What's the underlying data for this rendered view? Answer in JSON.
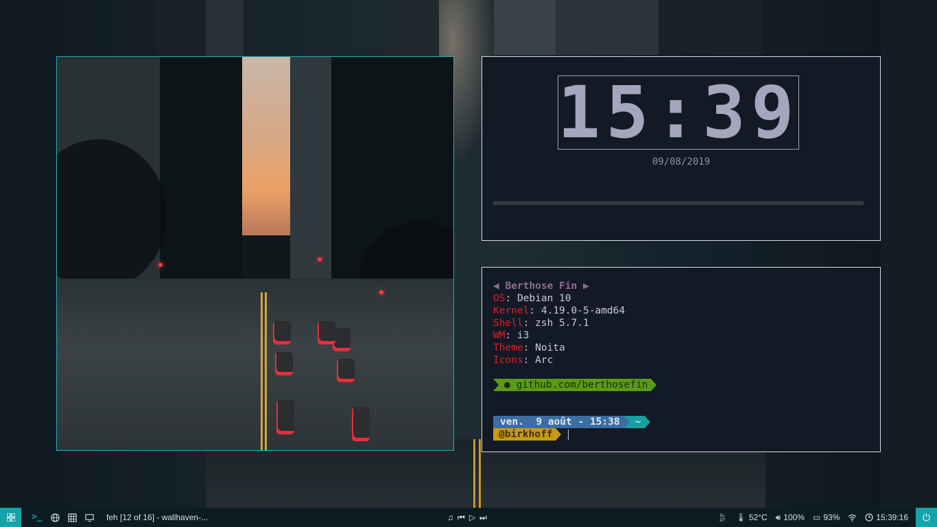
{
  "clock": {
    "time": "15:39",
    "date": "09/08/2019"
  },
  "neofetch": {
    "header": "Berthose Fin",
    "rows": [
      {
        "key": "OS",
        "value": "Debian 10"
      },
      {
        "key": "Kernel",
        "value": "4.19.0-5-amd64"
      },
      {
        "key": "Shell",
        "value": "zsh 5.7.1"
      },
      {
        "key": "WM",
        "value": "i3"
      },
      {
        "key": "Theme",
        "value": "Noita"
      },
      {
        "key": "Icons",
        "value": "Arc"
      }
    ],
    "github": "github.com/berthosefin"
  },
  "prompt": {
    "datetime": "ven.  9 août - 15:38",
    "dir": "~",
    "user": "@birkhoff"
  },
  "taskbar": {
    "window_title": "feh [12 of 16] - wallhaven-...",
    "temperature": "52°C",
    "volume": "100%",
    "battery": "93%",
    "time": "15:39:16",
    "terminal_icon": ">_"
  },
  "colors": {
    "accent": "#14a4aa",
    "panel_bg": "#131a25",
    "neofetch_key": "#d8212c",
    "github_segment": "#5a9b16",
    "date_segment": "#3a6ea5",
    "user_segment": "#c79a14"
  },
  "icons": {
    "menu": "grid-icon",
    "terminal": "terminal-icon",
    "browser": "globe-icon",
    "files": "table-icon",
    "display": "monitor-icon",
    "music": "music-note-icon",
    "prev": "skip-back-icon",
    "play": "play-icon",
    "next": "skip-forward-icon",
    "leaf": "leaf-icon",
    "thermometer": "thermometer-icon",
    "volume": "volume-icon",
    "battery": "battery-icon",
    "wifi": "wifi-icon",
    "clock": "clock-icon",
    "power": "power-icon"
  }
}
